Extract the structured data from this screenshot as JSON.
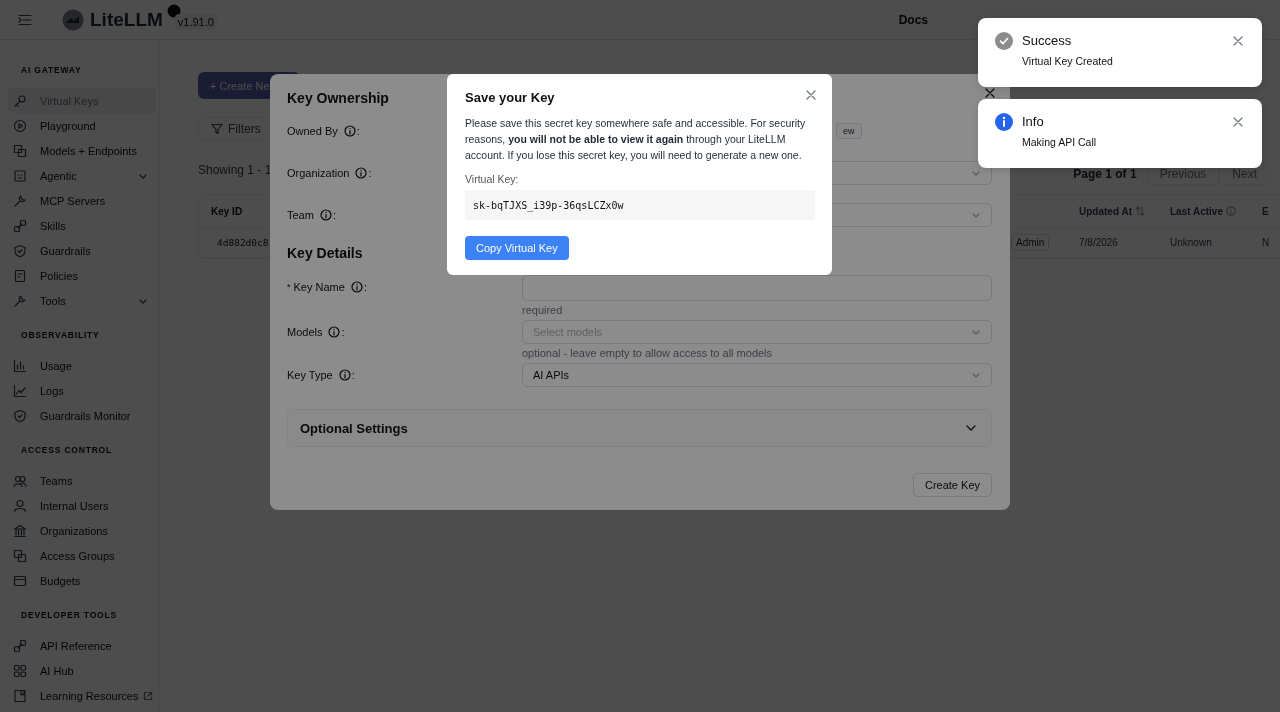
{
  "header": {
    "app_name": "LiteLLM",
    "version": "v1.91.0",
    "links": [
      "Docs"
    ]
  },
  "sidebar": {
    "sections": [
      {
        "title": "AI GATEWAY",
        "items": [
          {
            "label": "Virtual Keys",
            "selected": true
          },
          {
            "label": "Playground",
            "selected": false
          },
          {
            "label": "Models + Endpoints",
            "selected": false
          },
          {
            "label": "Agentic",
            "selected": false,
            "expanded": false
          },
          {
            "label": "MCP Servers",
            "selected": false
          },
          {
            "label": "Skills",
            "selected": false
          },
          {
            "label": "Guardrails",
            "selected": false
          },
          {
            "label": "Policies",
            "selected": false
          },
          {
            "label": "Tools",
            "selected": false,
            "expanded": false
          }
        ]
      },
      {
        "title": "OBSERVABILITY",
        "items": [
          {
            "label": "Usage",
            "selected": false
          },
          {
            "label": "Logs",
            "selected": false
          },
          {
            "label": "Guardrails Monitor",
            "selected": false
          }
        ]
      },
      {
        "title": "ACCESS CONTROL",
        "items": [
          {
            "label": "Teams",
            "selected": false
          },
          {
            "label": "Internal Users",
            "selected": false
          },
          {
            "label": "Organizations",
            "selected": false
          },
          {
            "label": "Access Groups",
            "selected": false
          },
          {
            "label": "Budgets",
            "selected": false
          }
        ]
      },
      {
        "title": "DEVELOPER TOOLS",
        "items": [
          {
            "label": "API Reference",
            "selected": false
          },
          {
            "label": "AI Hub",
            "selected": false
          },
          {
            "label": "Learning Resources",
            "selected": false,
            "external": true
          }
        ]
      }
    ]
  },
  "main": {
    "create_button": "+ Create Ne",
    "filters_button": "Filters",
    "showing": "Showing 1 - 1",
    "pagination": {
      "text": "Page 1 of 1",
      "buttons": [
        "Previous",
        "Next"
      ]
    },
    "table": {
      "columns": [
        "Key ID",
        "",
        "Updated At",
        "Last Active",
        "E"
      ],
      "rows": [
        [
          "4d882d0c8",
          "Admin",
          "7/8/2026",
          "Unknown",
          "N"
        ]
      ]
    }
  },
  "create_modal": {
    "label_suffix": ":",
    "sections": [
      {
        "title": "Key Ownership",
        "fields": [
          {
            "label": "Owned By",
            "kind": "tags",
            "tags": [
              "ew"
            ]
          },
          {
            "label": "Organization",
            "kind": "select"
          },
          {
            "label": "Team",
            "kind": "select"
          }
        ]
      },
      {
        "title": "Key Details",
        "fields": [
          {
            "label": "Key Name",
            "kind": "input",
            "marker": "*",
            "help": "required"
          },
          {
            "label": "Models",
            "kind": "select",
            "placeholder": "Select models",
            "help": "optional - leave empty to allow access to all models"
          },
          {
            "label": "Key Type",
            "kind": "select",
            "value": "AI APIs"
          }
        ]
      }
    ],
    "optional_settings": {
      "title": "Optional Settings",
      "expanded": false
    },
    "submit": "Create Key"
  },
  "save_modal": {
    "title": "Save your Key",
    "text": "Please save this secret key somewhere safe and accessible. For security reasons, **you will not be able to view it again** through your LiteLLM account. If you lose this secret key, you will need to generate a new one.",
    "key_label": "Virtual Key:",
    "key": "sk-bqTJXS_i39p-36qsLCZx0w",
    "copy_button": "Copy Virtual Key"
  },
  "toasts": [
    {
      "kind": "success",
      "title": "Success",
      "message": "Virtual Key Created"
    },
    {
      "kind": "info",
      "title": "Info",
      "message": "Making API Call"
    }
  ]
}
